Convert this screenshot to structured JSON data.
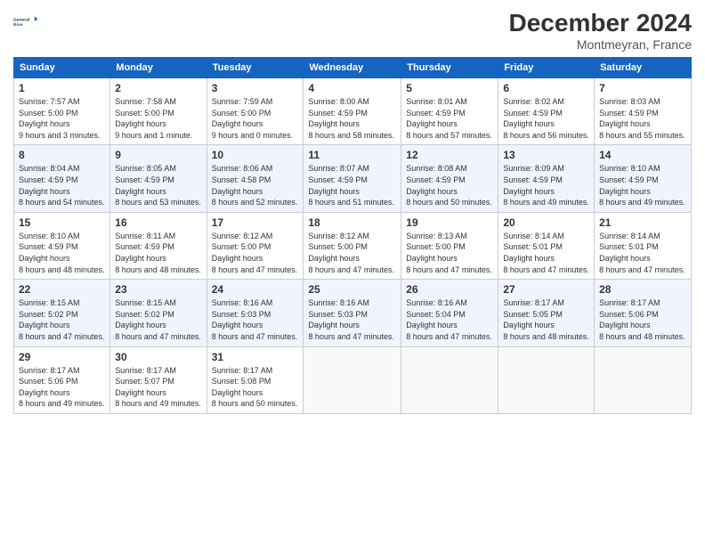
{
  "header": {
    "logo_line1": "General",
    "logo_line2": "Blue",
    "month_year": "December 2024",
    "location": "Montmeyran, France"
  },
  "weekdays": [
    "Sunday",
    "Monday",
    "Tuesday",
    "Wednesday",
    "Thursday",
    "Friday",
    "Saturday"
  ],
  "weeks": [
    [
      {
        "day": "1",
        "sunrise": "7:57 AM",
        "sunset": "5:00 PM",
        "daylight": "9 hours and 3 minutes."
      },
      {
        "day": "2",
        "sunrise": "7:58 AM",
        "sunset": "5:00 PM",
        "daylight": "9 hours and 1 minute."
      },
      {
        "day": "3",
        "sunrise": "7:59 AM",
        "sunset": "5:00 PM",
        "daylight": "9 hours and 0 minutes."
      },
      {
        "day": "4",
        "sunrise": "8:00 AM",
        "sunset": "4:59 PM",
        "daylight": "8 hours and 58 minutes."
      },
      {
        "day": "5",
        "sunrise": "8:01 AM",
        "sunset": "4:59 PM",
        "daylight": "8 hours and 57 minutes."
      },
      {
        "day": "6",
        "sunrise": "8:02 AM",
        "sunset": "4:59 PM",
        "daylight": "8 hours and 56 minutes."
      },
      {
        "day": "7",
        "sunrise": "8:03 AM",
        "sunset": "4:59 PM",
        "daylight": "8 hours and 55 minutes."
      }
    ],
    [
      {
        "day": "8",
        "sunrise": "8:04 AM",
        "sunset": "4:59 PM",
        "daylight": "8 hours and 54 minutes."
      },
      {
        "day": "9",
        "sunrise": "8:05 AM",
        "sunset": "4:59 PM",
        "daylight": "8 hours and 53 minutes."
      },
      {
        "day": "10",
        "sunrise": "8:06 AM",
        "sunset": "4:58 PM",
        "daylight": "8 hours and 52 minutes."
      },
      {
        "day": "11",
        "sunrise": "8:07 AM",
        "sunset": "4:59 PM",
        "daylight": "8 hours and 51 minutes."
      },
      {
        "day": "12",
        "sunrise": "8:08 AM",
        "sunset": "4:59 PM",
        "daylight": "8 hours and 50 minutes."
      },
      {
        "day": "13",
        "sunrise": "8:09 AM",
        "sunset": "4:59 PM",
        "daylight": "8 hours and 49 minutes."
      },
      {
        "day": "14",
        "sunrise": "8:10 AM",
        "sunset": "4:59 PM",
        "daylight": "8 hours and 49 minutes."
      }
    ],
    [
      {
        "day": "15",
        "sunrise": "8:10 AM",
        "sunset": "4:59 PM",
        "daylight": "8 hours and 48 minutes."
      },
      {
        "day": "16",
        "sunrise": "8:11 AM",
        "sunset": "4:59 PM",
        "daylight": "8 hours and 48 minutes."
      },
      {
        "day": "17",
        "sunrise": "8:12 AM",
        "sunset": "5:00 PM",
        "daylight": "8 hours and 47 minutes."
      },
      {
        "day": "18",
        "sunrise": "8:12 AM",
        "sunset": "5:00 PM",
        "daylight": "8 hours and 47 minutes."
      },
      {
        "day": "19",
        "sunrise": "8:13 AM",
        "sunset": "5:00 PM",
        "daylight": "8 hours and 47 minutes."
      },
      {
        "day": "20",
        "sunrise": "8:14 AM",
        "sunset": "5:01 PM",
        "daylight": "8 hours and 47 minutes."
      },
      {
        "day": "21",
        "sunrise": "8:14 AM",
        "sunset": "5:01 PM",
        "daylight": "8 hours and 47 minutes."
      }
    ],
    [
      {
        "day": "22",
        "sunrise": "8:15 AM",
        "sunset": "5:02 PM",
        "daylight": "8 hours and 47 minutes."
      },
      {
        "day": "23",
        "sunrise": "8:15 AM",
        "sunset": "5:02 PM",
        "daylight": "8 hours and 47 minutes."
      },
      {
        "day": "24",
        "sunrise": "8:16 AM",
        "sunset": "5:03 PM",
        "daylight": "8 hours and 47 minutes."
      },
      {
        "day": "25",
        "sunrise": "8:16 AM",
        "sunset": "5:03 PM",
        "daylight": "8 hours and 47 minutes."
      },
      {
        "day": "26",
        "sunrise": "8:16 AM",
        "sunset": "5:04 PM",
        "daylight": "8 hours and 47 minutes."
      },
      {
        "day": "27",
        "sunrise": "8:17 AM",
        "sunset": "5:05 PM",
        "daylight": "8 hours and 48 minutes."
      },
      {
        "day": "28",
        "sunrise": "8:17 AM",
        "sunset": "5:06 PM",
        "daylight": "8 hours and 48 minutes."
      }
    ],
    [
      {
        "day": "29",
        "sunrise": "8:17 AM",
        "sunset": "5:06 PM",
        "daylight": "8 hours and 49 minutes."
      },
      {
        "day": "30",
        "sunrise": "8:17 AM",
        "sunset": "5:07 PM",
        "daylight": "8 hours and 49 minutes."
      },
      {
        "day": "31",
        "sunrise": "8:17 AM",
        "sunset": "5:08 PM",
        "daylight": "8 hours and 50 minutes."
      },
      null,
      null,
      null,
      null
    ]
  ]
}
